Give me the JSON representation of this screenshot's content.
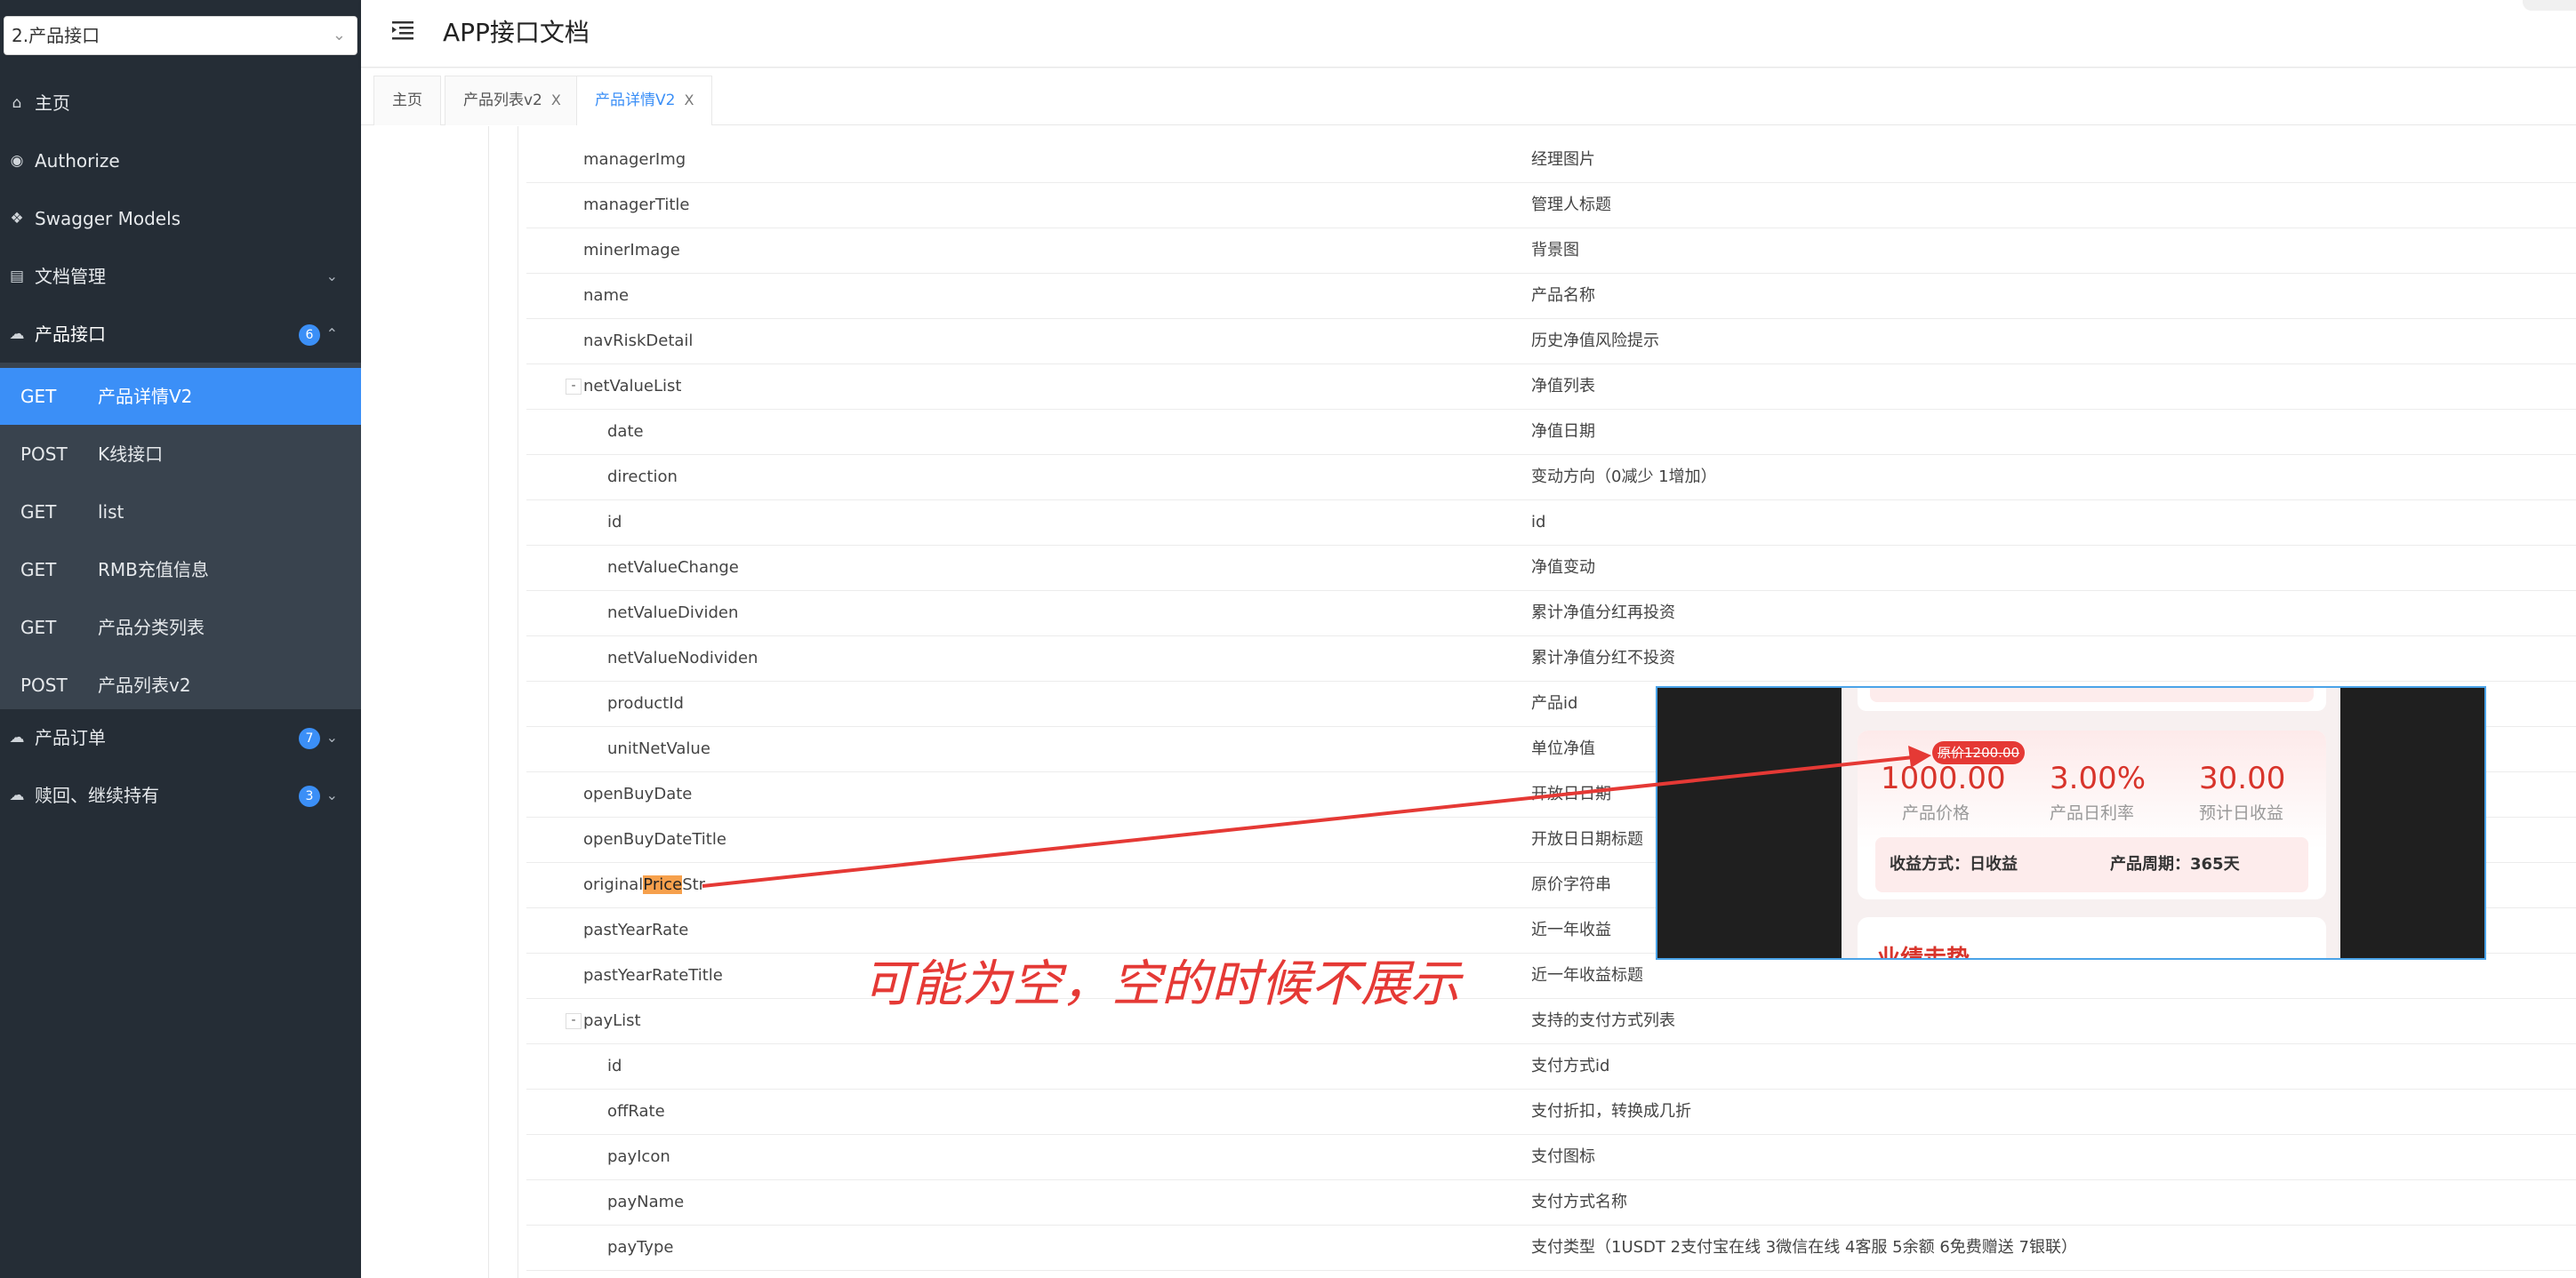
{
  "sidebar": {
    "group_select": "2.产品接口",
    "items": [
      {
        "icon": "home-icon",
        "label": "主页"
      },
      {
        "icon": "lock-icon",
        "label": "Authorize"
      },
      {
        "icon": "cube-icon",
        "label": "Swagger Models"
      },
      {
        "icon": "document-icon",
        "label": "文档管理"
      },
      {
        "icon": "cloud-icon",
        "label": "产品接口",
        "badge": "6"
      },
      {
        "icon": "cloud-icon",
        "label": "产品订单",
        "badge": "7"
      },
      {
        "icon": "cloud-icon",
        "label": "赎回、继续持有",
        "badge": "3"
      }
    ],
    "sub_items": [
      {
        "method": "GET",
        "label": "产品详情V2"
      },
      {
        "method": "POST",
        "label": "K线接口"
      },
      {
        "method": "GET",
        "label": "list"
      },
      {
        "method": "GET",
        "label": "RMB充值信息"
      },
      {
        "method": "GET",
        "label": "产品分类列表"
      },
      {
        "method": "POST",
        "label": "产品列表v2"
      }
    ]
  },
  "header": {
    "title": "APP接口文档"
  },
  "tabs": [
    {
      "label": "主页"
    },
    {
      "label": "产品列表v2",
      "close": "X"
    },
    {
      "label": "产品详情V2",
      "close": "X"
    }
  ],
  "fields": [
    {
      "name": "managerImg",
      "desc": "经理图片"
    },
    {
      "name": "managerTitle",
      "desc": "管理人标题"
    },
    {
      "name": "minerImage",
      "desc": "背景图"
    },
    {
      "name": "name",
      "desc": "产品名称"
    },
    {
      "name": "navRiskDetail",
      "desc": "历史净值风险提示"
    },
    {
      "name": "netValueList",
      "desc": "净值列表",
      "toggle": "-"
    },
    {
      "name": "date",
      "desc": "净值日期"
    },
    {
      "name": "direction",
      "desc": "变动方向（0减少 1增加）"
    },
    {
      "name": "id",
      "desc": "id"
    },
    {
      "name": "netValueChange",
      "desc": "净值变动"
    },
    {
      "name": "netValueDividen",
      "desc": "累计净值分红再投资"
    },
    {
      "name": "netValueNodividen",
      "desc": "累计净值分红不投资"
    },
    {
      "name": "productId",
      "desc": "产品id"
    },
    {
      "name": "unitNetValue",
      "desc": "单位净值"
    },
    {
      "name": "openBuyDate",
      "desc": "开放日日期"
    },
    {
      "name": "openBuyDateTitle",
      "desc": "开放日日期标题"
    },
    {
      "name_pre": "original",
      "name_hl": "Price",
      "name_post": "Str",
      "desc": "原价字符串"
    },
    {
      "name": "pastYearRate",
      "desc": "近一年收益"
    },
    {
      "name": "pastYearRateTitle",
      "desc": "近一年收益标题"
    },
    {
      "name": "payList",
      "desc": "支持的支付方式列表",
      "toggle": "-"
    },
    {
      "name": "id",
      "desc": "支付方式id"
    },
    {
      "name": "offRate",
      "desc": "支付折扣，转换成几折"
    },
    {
      "name": "payIcon",
      "desc": "支付图标"
    },
    {
      "name": "payName",
      "desc": "支付方式名称"
    },
    {
      "name": "payType",
      "desc": "支付类型（1USDT 2支付宝在线 3微信在线 4客服 5余额 6免费赠送 7银联）"
    }
  ],
  "annotation": {
    "note": "可能为空，空的时候不展示",
    "color": "#e53935"
  },
  "preview": {
    "original_price": "原价1200.00",
    "stats": [
      {
        "value": "1000.00",
        "label": "产品价格"
      },
      {
        "value": "3.00%",
        "label": "产品日利率"
      },
      {
        "value": "30.00",
        "label": "预计日收益"
      }
    ],
    "income_method": "收益方式：日收益",
    "product_period": "产品周期：365天",
    "trend_title": "业绩走势"
  },
  "colors": {
    "sidebar_bg": "#252d36",
    "submenu_bg": "#39434e",
    "accent": "#3b8ff7",
    "highlight": "#f6a04c"
  }
}
